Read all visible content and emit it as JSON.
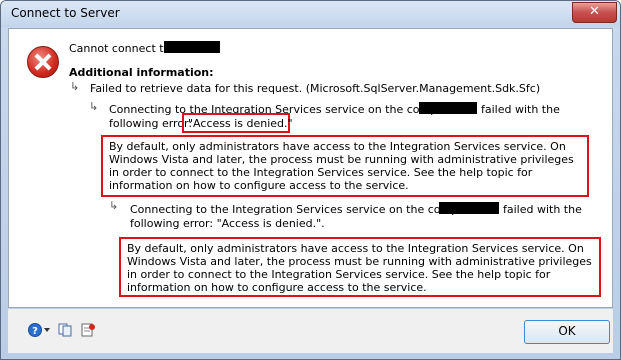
{
  "window": {
    "title": "Connect to Server",
    "close_label": "✕"
  },
  "message": {
    "cannot_connect": "Cannot connect to",
    "additional_info": "Additional information:",
    "level1": "Failed to retrieve data for this request. (Microsoft.SqlServer.Management.Sdk.Sfc)",
    "level2_line1a": "Connecting to the Integration Services service on the computer",
    "level2_line1b": "failed with the",
    "level2_line2a": "following error:",
    "level2_error": "\"Access is denied.\"",
    "level2_detail": "By default, only administrators have access to the Integration Services service. On Windows Vista and later, the process must be running with administrative privileges in order to connect to the Integration Services service. See the help topic for information on how to configure access to the service.",
    "level3_line1a": "Connecting to the Integration Services service on the computer",
    "level3_line1b": "failed with the",
    "level3_line2": "following error: \"Access is denied.\".",
    "level3_detail": "By default, only administrators have access to the Integration Services service. On Windows Vista and later, the process must be running with administrative privileges in order to connect to the Integration Services service. See the help topic for information on how to configure access to the service."
  },
  "footer": {
    "ok_label": "OK",
    "help_icon": "help-icon",
    "copy_icon": "copy-icon",
    "details_icon": "details-icon"
  },
  "colors": {
    "highlight_border": "#e0101e",
    "accent": "#3a8ad6"
  }
}
